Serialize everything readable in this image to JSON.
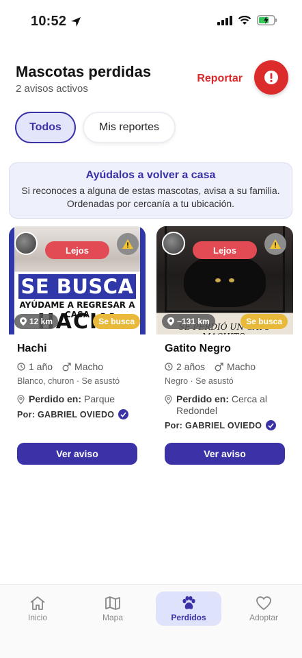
{
  "status_bar": {
    "time": "10:52"
  },
  "header": {
    "title": "Mascotas perdidas",
    "subtitle": "2 avisos activos",
    "report_label": "Reportar",
    "alert_symbol": "!"
  },
  "filters": [
    {
      "label": "Todos",
      "active": true
    },
    {
      "label": "Mis reportes",
      "active": false
    }
  ],
  "banner": {
    "title": "Ayúdalos a volver a casa",
    "text": "Si reconoces a alguna de estas mascotas, avisa a su familia. Ordenadas por cercanía a tu ubicación."
  },
  "cards": [
    {
      "name": "Hachi",
      "distance_label": "Lejos",
      "km": "12 km",
      "status": "Se busca",
      "age": "1 año",
      "sex": "Macho",
      "description": "Blanco, churon · Se asustó",
      "location_label": "Perdido en:",
      "location": "Parque",
      "owner": "Por: GABRIEL OVIEDO",
      "button": "Ver aviso",
      "poster_headline": "SE BUSCA",
      "poster_sub": "AYÚDAME A REGRESAR A CASA",
      "poster_name": "HACHI"
    },
    {
      "name": "Gatito Negro",
      "distance_label": "Lejos",
      "km": "~131 km",
      "status": "Se busca",
      "age": "2 años",
      "sex": "Macho",
      "description": "Negro · Se asustó",
      "location_label": "Perdido en:",
      "location": "Cerca al Redondel",
      "owner": "Por: GABRIEL OVIEDO",
      "button": "Ver aviso",
      "poster_caption": "SE PERDIÓ UN GATO MACHITO,"
    }
  ],
  "nav": [
    {
      "label": "Inicio",
      "icon": "home-icon",
      "active": false
    },
    {
      "label": "Mapa",
      "icon": "map-icon",
      "active": false
    },
    {
      "label": "Perdidos",
      "icon": "paw-icon",
      "active": true
    },
    {
      "label": "Adoptar",
      "icon": "heart-icon",
      "active": false
    }
  ],
  "colors": {
    "primary": "#3a32a6",
    "danger": "#dc2b2b",
    "distance_badge": "#e24b53",
    "seeking_badge": "#e8b93a",
    "banner_bg": "#eef0fb"
  }
}
